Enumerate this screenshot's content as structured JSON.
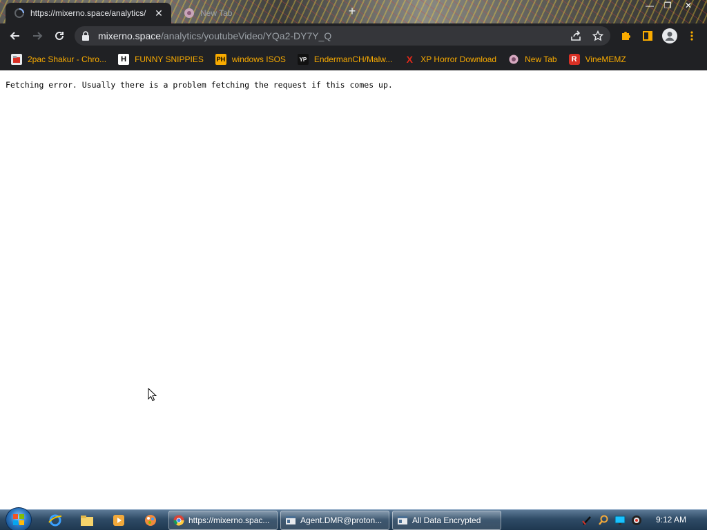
{
  "browser": {
    "tabs": [
      {
        "title": "https://mixerno.space/analytics/",
        "active": true
      },
      {
        "title": "New Tab",
        "active": false
      }
    ],
    "address": {
      "host": "mixerno.space",
      "path": "/analytics/youtubeVideo/YQa2-DY7Y_Q"
    },
    "bookmarks": [
      {
        "label": "2pac Shakur - Chro...",
        "icon": "folder-icon"
      },
      {
        "label": "FUNNY SNIPPIES",
        "icon": "h-logo-icon",
        "glyph": "H"
      },
      {
        "label": "windows ISOS",
        "icon": "ph-logo-icon",
        "glyph": "PH"
      },
      {
        "label": "EndermanCH/Malw...",
        "icon": "yp-logo-icon",
        "glyph": "YP"
      },
      {
        "label": "XP Horror Download",
        "icon": "x-logo-icon",
        "glyph": "X"
      },
      {
        "label": "New Tab",
        "icon": "globe-icon"
      },
      {
        "label": "VineMEMZ",
        "icon": "r-logo-icon",
        "glyph": "R"
      }
    ]
  },
  "page": {
    "message": "Fetching error. Usually there is a problem fetching the request if this comes up."
  },
  "taskbar": {
    "windows": [
      {
        "label": "https://mixerno.spac...",
        "icon": "chrome-icon"
      },
      {
        "label": "Agent.DMR@proton...",
        "icon": "window-icon"
      },
      {
        "label": "All Data Encrypted",
        "icon": "window-icon"
      }
    ],
    "clock": "9:12 AM"
  },
  "colors": {
    "chrome_dark": "#202124",
    "bookmark_text": "#f9ab00",
    "omnibox": "#35363a"
  }
}
